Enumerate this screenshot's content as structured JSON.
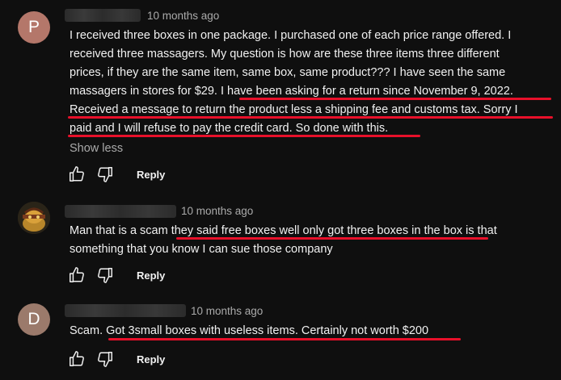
{
  "comments": [
    {
      "avatar_letter": "P",
      "avatar_color": "#b4776a",
      "timestamp": "10 months ago",
      "lines": [
        "I received three boxes in one package. I purchased one of each price range offered. I",
        "received three massagers.  My question is how are these three items three different",
        "prices, if they are the same item, same box, same product???  I have seen the same",
        "massagers in stores for $29.   I have been asking for a return since November 9, 2022.",
        "Received a message to return the product less a shipping fee and customs tax.  Sorry I",
        "paid and I will refuse to pay the credit card.  So done with this."
      ],
      "show_less_label": "Show less",
      "reply_label": "Reply"
    },
    {
      "timestamp": "10 months ago",
      "lines": [
        "Man that is a scam they said free boxes well only got three boxes in the box is that",
        "something that you know I can sue those company"
      ],
      "reply_label": "Reply"
    },
    {
      "avatar_letter": "D",
      "avatar_color": "#9b7a6b",
      "timestamp": "10 months ago",
      "lines": [
        "Scam. Got 3small boxes with useless items. Certainly not worth $200"
      ],
      "reply_label": "Reply"
    }
  ],
  "icons": {
    "like": "thumbs-up-icon",
    "dislike": "thumbs-down-icon"
  },
  "colors": {
    "background": "#0f0f0f",
    "text": "#f1f1f1",
    "secondary_text": "#aaaaaa",
    "highlight_underline": "#e8102a"
  }
}
